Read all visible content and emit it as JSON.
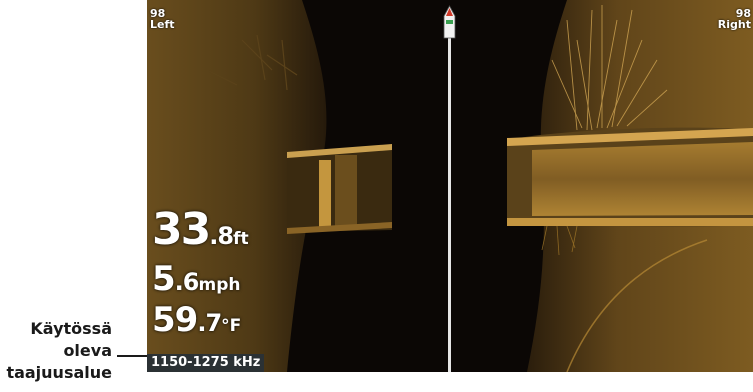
{
  "annotation": {
    "lines": [
      "Käytössä",
      "oleva",
      "taajuusalue"
    ]
  },
  "sonar": {
    "left_range": "98",
    "left_label": "Left",
    "right_range": "98",
    "right_label": "Right",
    "depth": {
      "whole": "33",
      "decimal": ".8",
      "unit": "ft"
    },
    "speed": {
      "whole": "5",
      "decimal": ".6",
      "unit": "mph"
    },
    "temperature": {
      "whole": "59",
      "decimal": ".7",
      "unit": "°F"
    },
    "frequency": "1150-1275 kHz"
  },
  "colors": {
    "sonar_return": "#a77a2a",
    "water": "#0b0705",
    "frequency_badge": "#2b3134",
    "center_line": "#e6e6e6"
  },
  "icons": {
    "boat": "boat-icon"
  }
}
